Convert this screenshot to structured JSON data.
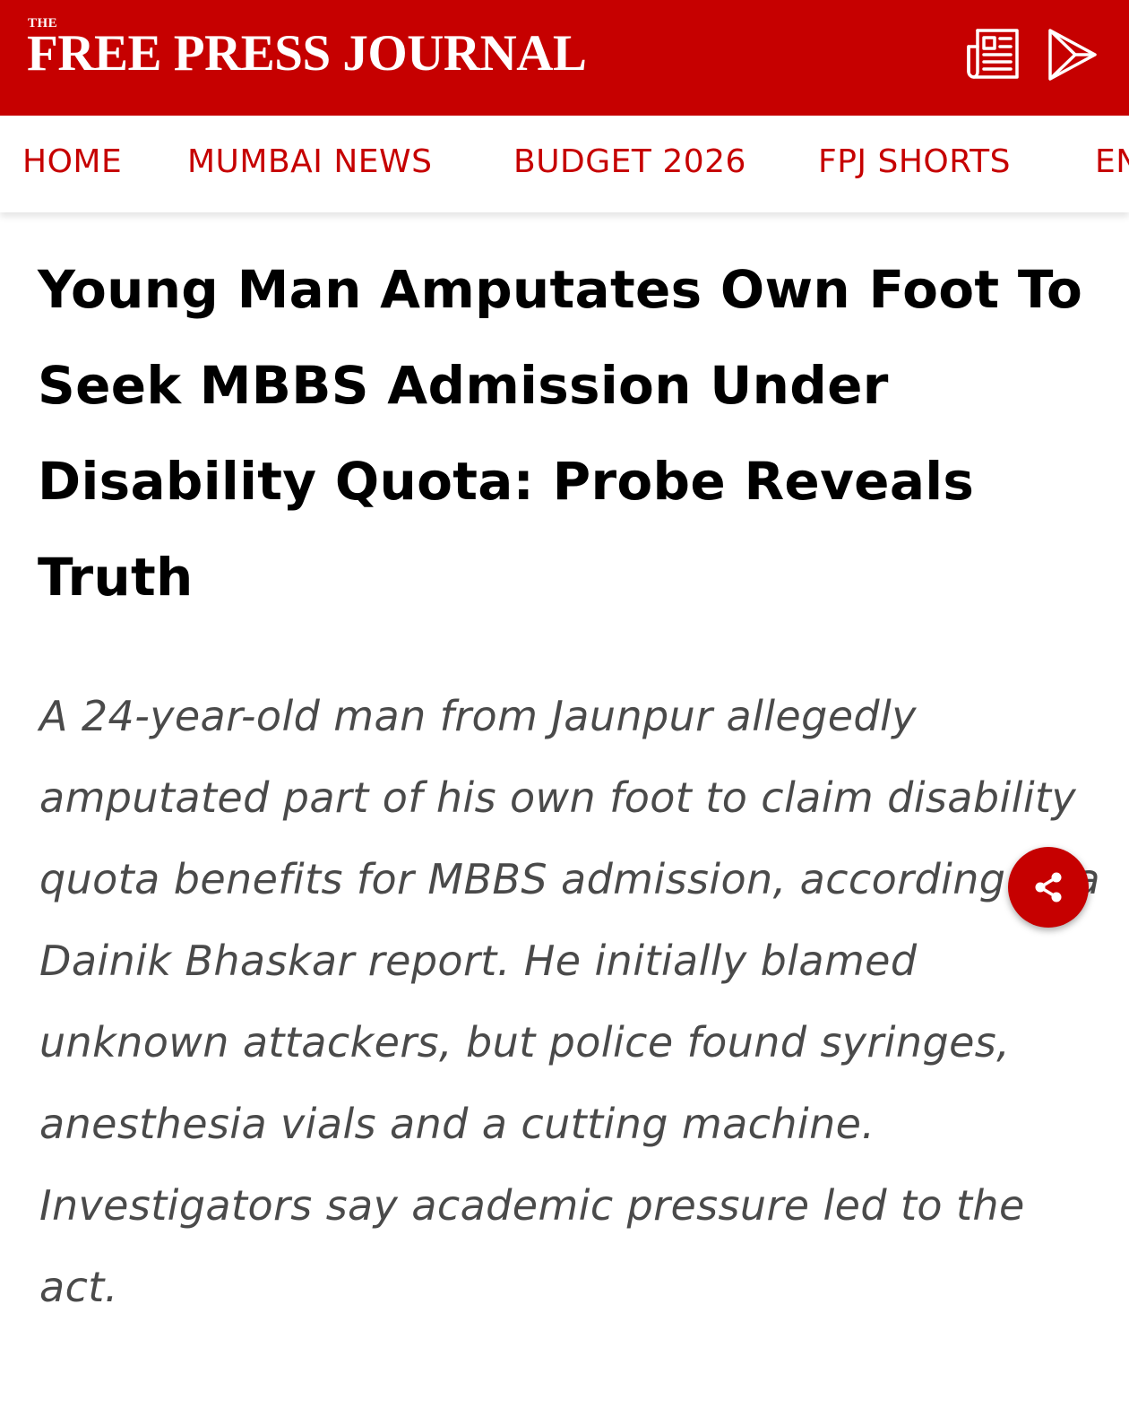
{
  "header": {
    "logo_small": "THE",
    "logo_main": "FREE PRESS JOURNAL",
    "epaper_icon": "newspaper-icon",
    "play_icon": "google-play-icon",
    "brand_color": "#c60000"
  },
  "nav": {
    "items": [
      "HOME",
      "MUMBAI NEWS",
      "BUDGET 2026",
      "FPJ SHORTS",
      "EN"
    ]
  },
  "article": {
    "headline": "Young Man Amputates Own Foot To Seek MBBS Admission Under Disability Quota: Probe Reveals Truth",
    "summary": "A 24-year-old man from Jaunpur allegedly amputated part of his own foot to claim disability quota benefits for MBBS admission, according to a Dainik Bhaskar report. He initially blamed unknown attackers, but police found syringes, anesthesia vials and a cutting machine. Investigators say academic pressure led to the act."
  },
  "share_button": {
    "icon": "share-icon"
  }
}
